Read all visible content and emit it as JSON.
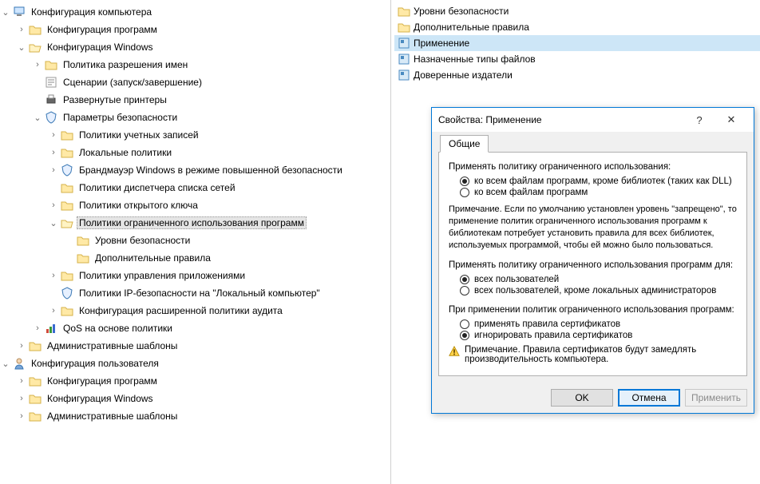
{
  "tree": {
    "computer_config": "Конфигурация компьютера",
    "comp_programs": "Конфигурация программ",
    "win_config": "Конфигурация Windows",
    "name_policy": "Политика разрешения имен",
    "scripts": "Сценарии (запуск/завершение)",
    "printers": "Развернутые принтеры",
    "security_params": "Параметры безопасности",
    "account_policies": "Политики учетных записей",
    "local_policies": "Локальные политики",
    "firewall": "Брандмауэр Windows в режиме повышенной безопасности",
    "netlist": "Политики диспетчера списка сетей",
    "pubkey": "Политики открытого ключа",
    "srp": "Политики ограниченного использования программ",
    "sec_levels": "Уровни безопасности",
    "add_rules": "Дополнительные правила",
    "app_ctrl": "Политики управления приложениями",
    "ipsec": "Политики IP-безопасности на \"Локальный компьютер\"",
    "adv_audit": "Конфигурация расширенной политики аудита",
    "qos": "QoS на основе политики",
    "admin_templates": "Административные шаблоны",
    "user_config": "Конфигурация пользователя",
    "user_programs": "Конфигурация программ",
    "user_windows": "Конфигурация Windows",
    "user_admin": "Административные шаблоны"
  },
  "list": {
    "sec_levels": "Уровни безопасности",
    "add_rules": "Дополнительные правила",
    "enforcement": "Применение",
    "file_types": "Назначенные типы файлов",
    "publishers": "Доверенные издатели"
  },
  "dialog": {
    "title": "Свойства: Применение",
    "tab_general": "Общие",
    "group1_label": "Применять политику ограниченного использования:",
    "g1_opt1": "ко всем файлам программ, кроме библиотек (таких как DLL)",
    "g1_opt2": "ко всем файлам программ",
    "note1": "Примечание. Если по умолчанию установлен уровень \"запрещено\", то применение политик ограниченного использования программ к библиотекам потребует установить правила для всех библиотек, используемых  программой, чтобы ей можно было пользоваться.",
    "group2_label": "Применять политику ограниченного использования программ для:",
    "g2_opt1": "всех пользователей",
    "g2_opt2": "всех пользователей, кроме локальных администраторов",
    "group3_label": "При применении политик ограниченного использования программ:",
    "g3_opt1": "применять правила сертификатов",
    "g3_opt2": "игнорировать правила сертификатов",
    "note2": "Примечание. Правила сертификатов будут замедлять производительность компьютера.",
    "ok": "OK",
    "cancel": "Отмена",
    "apply": "Применить",
    "help": "?",
    "close": "✕"
  }
}
